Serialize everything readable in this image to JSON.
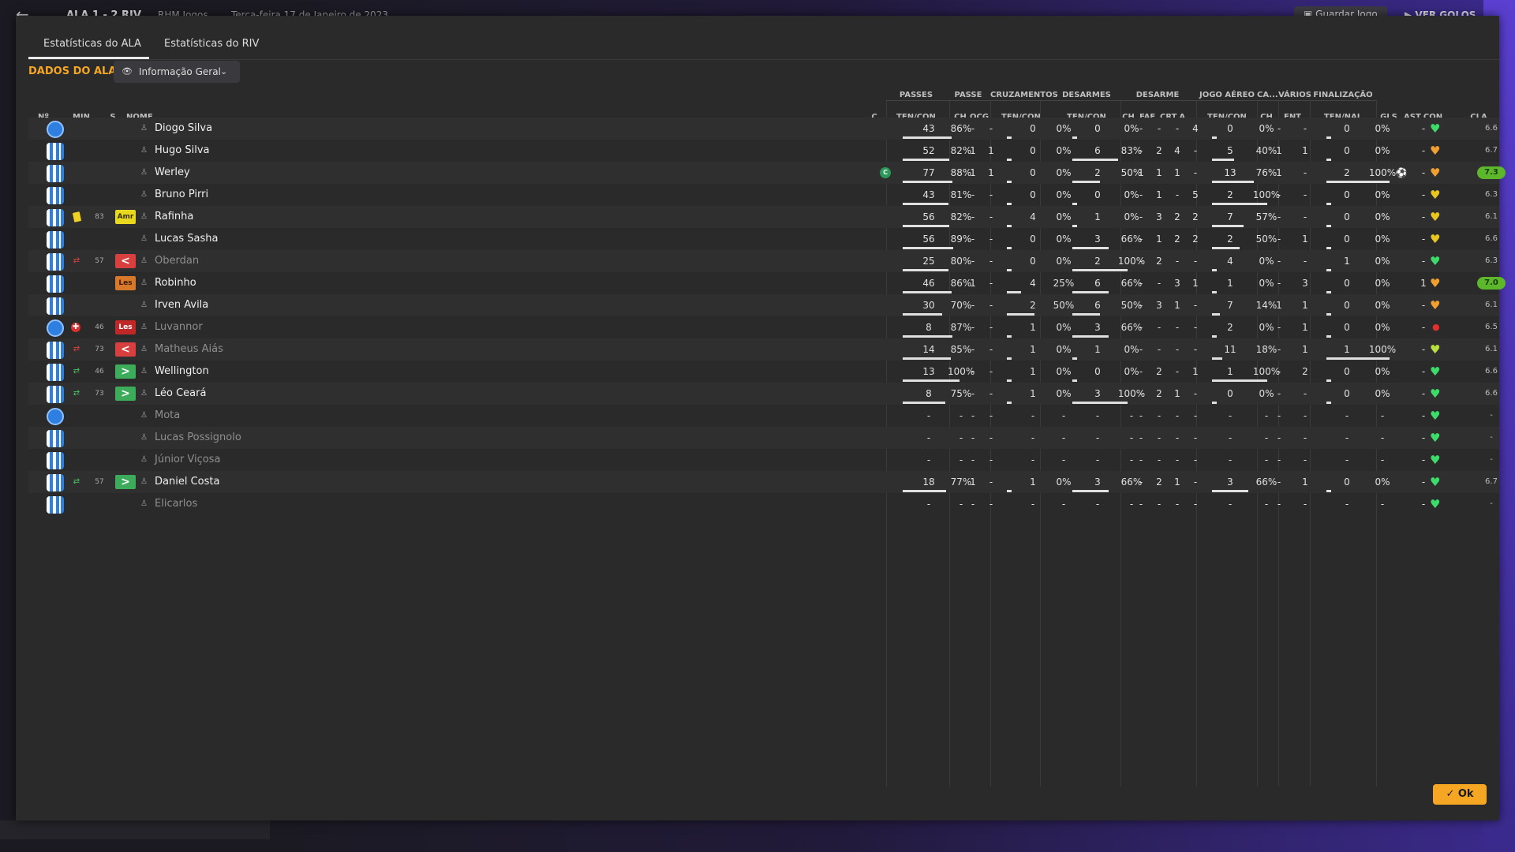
{
  "topbar": {
    "score": "ALA 1 - 2 RIV",
    "opponent": "RHM Jogos",
    "date": "Terça-feira 17 de Janeiro de 2023",
    "save_label": "Guardar Jogo",
    "goals_label": "VER GOLOS"
  },
  "tabs": [
    {
      "label": "Estatísticas do ALA",
      "active": true
    },
    {
      "label": "Estatísticas do RIV",
      "active": false
    }
  ],
  "section_title": "DADOS DO ALA",
  "view_select": {
    "value": "Informação Geral"
  },
  "column_groups": [
    "PASSES",
    "PASSE",
    "CRUZAMENTOS",
    "DESARMES",
    "DESARME",
    "JOGO AÉREO",
    "CA...",
    "VÁRIOS",
    "FINALIZAÇÃO"
  ],
  "column_headers": {
    "num": "Nº",
    "min": "MIN",
    "s": "S",
    "nome": "NOME",
    "c": "C",
    "passes": "TEN/CON",
    "passe_ch": "CH",
    "passe_ocg": "OCG",
    "cruz": "TEN/CON",
    "desarmes": "TEN/CON",
    "des_ch": "CH",
    "des_faf": "FAF",
    "des_crt": "CRT",
    "des_a": "A...",
    "aereo": "TEN/CON",
    "ca_ch": "CH",
    "varios_fnt": "FNT",
    "final": "TEN/NAL",
    "gls": "GLS",
    "ast": "AST",
    "con": "CON",
    "cla": "CLA"
  },
  "colors": {
    "accent": "#f5a623",
    "good_rating": "#5cb82a",
    "kit_blue": "#2e7fe0"
  },
  "players": [
    {
      "name": "Diogo Silva",
      "kit": "gk",
      "evt": "",
      "min": "",
      "sub": "",
      "pass": [
        "43",
        "86%"
      ],
      "pch": "-",
      "pocg": "-",
      "cr": [
        "0",
        "0%"
      ],
      "ds": [
        "0",
        "0%"
      ],
      "dch": "-",
      "faf": "-",
      "crt": "-",
      "da": "4",
      "ae": [
        "0",
        "0%"
      ],
      "cach": "-",
      "fnt": "-",
      "fn": [
        "0",
        "0%"
      ],
      "gls": "",
      "ast": "-",
      "heart": "green",
      "cla": "6.6",
      "claGood": false
    },
    {
      "name": "Hugo Silva",
      "kit": "out",
      "evt": "",
      "min": "",
      "sub": "",
      "pass": [
        "52",
        "82%"
      ],
      "pch": "1",
      "pocg": "1",
      "cr": [
        "0",
        "0%"
      ],
      "ds": [
        "6",
        "83%"
      ],
      "dch": "-",
      "faf": "2",
      "crt": "4",
      "da": "-",
      "ae": [
        "5",
        "40%"
      ],
      "cach": "1",
      "fnt": "1",
      "fn": [
        "0",
        "0%"
      ],
      "gls": "",
      "ast": "-",
      "heart": "orange",
      "cla": "6.7",
      "claGood": false
    },
    {
      "name": "Werley",
      "kit": "out",
      "evt": "",
      "min": "",
      "sub": "",
      "cap": "C",
      "pass": [
        "77",
        "88%"
      ],
      "pch": "1",
      "pocg": "1",
      "cr": [
        "0",
        "0%"
      ],
      "ds": [
        "2",
        "50%"
      ],
      "dch": "1",
      "faf": "1",
      "crt": "1",
      "da": "-",
      "ae": [
        "13",
        "76%"
      ],
      "cach": "1",
      "fnt": "-",
      "fn": [
        "2",
        "100%"
      ],
      "gls": "⚽",
      "ast": "-",
      "heart": "orange",
      "cla": "7.3",
      "claGood": true
    },
    {
      "name": "Bruno Pirri",
      "kit": "out",
      "evt": "",
      "min": "",
      "sub": "",
      "pass": [
        "43",
        "81%"
      ],
      "pch": "-",
      "pocg": "-",
      "cr": [
        "0",
        "0%"
      ],
      "ds": [
        "0",
        "0%"
      ],
      "dch": "-",
      "faf": "1",
      "crt": "-",
      "da": "5",
      "ae": [
        "2",
        "100%"
      ],
      "cach": "-",
      "fnt": "-",
      "fn": [
        "0",
        "0%"
      ],
      "gls": "",
      "ast": "-",
      "heart": "yellow",
      "cla": "6.3",
      "claGood": false
    },
    {
      "name": "Rafinha",
      "kit": "out",
      "evt": "yellow",
      "min": "83",
      "sub": "Amr",
      "subType": "amr",
      "pass": [
        "56",
        "82%"
      ],
      "pch": "-",
      "pocg": "-",
      "cr": [
        "4",
        "0%"
      ],
      "ds": [
        "1",
        "0%"
      ],
      "dch": "-",
      "faf": "3",
      "crt": "2",
      "da": "2",
      "ae": [
        "7",
        "57%"
      ],
      "cach": "-",
      "fnt": "-",
      "fn": [
        "0",
        "0%"
      ],
      "gls": "",
      "ast": "-",
      "heart": "yellow",
      "cla": "6.1",
      "claGood": false
    },
    {
      "name": "Lucas Sasha",
      "kit": "out",
      "evt": "",
      "min": "",
      "sub": "",
      "pass": [
        "56",
        "89%"
      ],
      "pch": "-",
      "pocg": "-",
      "cr": [
        "0",
        "0%"
      ],
      "ds": [
        "3",
        "66%"
      ],
      "dch": "-",
      "faf": "1",
      "crt": "2",
      "da": "2",
      "ae": [
        "2",
        "50%"
      ],
      "cach": "-",
      "fnt": "1",
      "fn": [
        "0",
        "0%"
      ],
      "gls": "",
      "ast": "-",
      "heart": "yellow",
      "cla": "6.6",
      "claGood": false
    },
    {
      "name": "Oberdan",
      "kit": "out",
      "evt": "subout",
      "min": "57",
      "sub": "<",
      "subType": "out",
      "dim": true,
      "pass": [
        "25",
        "80%"
      ],
      "pch": "-",
      "pocg": "-",
      "cr": [
        "0",
        "0%"
      ],
      "ds": [
        "2",
        "100%"
      ],
      "dch": "-",
      "faf": "2",
      "crt": "-",
      "da": "-",
      "ae": [
        "4",
        "0%"
      ],
      "cach": "-",
      "fnt": "-",
      "fn": [
        "1",
        "0%"
      ],
      "gls": "",
      "ast": "-",
      "heart": "green",
      "cla": "6.3",
      "claGood": false
    },
    {
      "name": "Robinho",
      "kit": "out",
      "evt": "",
      "min": "",
      "sub": "Les",
      "subType": "les",
      "pass": [
        "46",
        "86%"
      ],
      "pch": "1",
      "pocg": "-",
      "cr": [
        "4",
        "25%"
      ],
      "ds": [
        "6",
        "66%"
      ],
      "dch": "-",
      "faf": "-",
      "crt": "3",
      "da": "1",
      "ae": [
        "1",
        "0%"
      ],
      "cach": "-",
      "fnt": "3",
      "fn": [
        "0",
        "0%"
      ],
      "gls": "",
      "ast": "1",
      "heart": "orange",
      "cla": "7.0",
      "claGood": true
    },
    {
      "name": "Irven Avila",
      "kit": "out",
      "evt": "",
      "min": "",
      "sub": "",
      "pass": [
        "30",
        "70%"
      ],
      "pch": "-",
      "pocg": "-",
      "cr": [
        "2",
        "50%"
      ],
      "ds": [
        "6",
        "50%"
      ],
      "dch": "-",
      "faf": "3",
      "crt": "1",
      "da": "-",
      "ae": [
        "7",
        "14%"
      ],
      "cach": "1",
      "fnt": "1",
      "fn": [
        "0",
        "0%"
      ],
      "gls": "",
      "ast": "-",
      "heart": "orange",
      "cla": "6.1",
      "claGood": false
    },
    {
      "name": "Luvannor",
      "kit": "gk",
      "evt": "injury",
      "min": "46",
      "sub": "Les",
      "subType": "lesred",
      "dim": true,
      "pass": [
        "8",
        "87%"
      ],
      "pch": "-",
      "pocg": "-",
      "cr": [
        "1",
        "0%"
      ],
      "ds": [
        "3",
        "66%"
      ],
      "dch": "-",
      "faf": "-",
      "crt": "-",
      "da": "-",
      "ae": [
        "2",
        "0%"
      ],
      "cach": "-",
      "fnt": "1",
      "fn": [
        "0",
        "0%"
      ],
      "gls": "",
      "ast": "-",
      "heart": "red",
      "cla": "6.5",
      "claGood": false
    },
    {
      "name": "Matheus Aiás",
      "kit": "out",
      "evt": "subout",
      "min": "73",
      "sub": "<",
      "subType": "out",
      "dim": true,
      "pass": [
        "14",
        "85%"
      ],
      "pch": "-",
      "pocg": "-",
      "cr": [
        "1",
        "0%"
      ],
      "ds": [
        "1",
        "0%"
      ],
      "dch": "-",
      "faf": "-",
      "crt": "-",
      "da": "-",
      "ae": [
        "11",
        "18%"
      ],
      "cach": "-",
      "fnt": "1",
      "fn": [
        "1",
        "100%"
      ],
      "gls": "",
      "ast": "-",
      "heart": "lime",
      "cla": "6.1",
      "claGood": false
    },
    {
      "name": "Wellington",
      "kit": "out",
      "evt": "subin",
      "min": "46",
      "sub": ">",
      "subType": "in",
      "pass": [
        "13",
        "100%"
      ],
      "pch": "-",
      "pocg": "-",
      "cr": [
        "1",
        "0%"
      ],
      "ds": [
        "0",
        "0%"
      ],
      "dch": "-",
      "faf": "2",
      "crt": "-",
      "da": "1",
      "ae": [
        "1",
        "100%"
      ],
      "cach": "-",
      "fnt": "2",
      "fn": [
        "0",
        "0%"
      ],
      "gls": "",
      "ast": "-",
      "heart": "green",
      "cla": "6.6",
      "claGood": false
    },
    {
      "name": "Léo Ceará",
      "kit": "out",
      "evt": "subin",
      "min": "73",
      "sub": ">",
      "subType": "in",
      "pass": [
        "8",
        "75%"
      ],
      "pch": "-",
      "pocg": "-",
      "cr": [
        "1",
        "0%"
      ],
      "ds": [
        "3",
        "100%"
      ],
      "dch": "-",
      "faf": "2",
      "crt": "1",
      "da": "-",
      "ae": [
        "0",
        "0%"
      ],
      "cach": "-",
      "fnt": "-",
      "fn": [
        "0",
        "0%"
      ],
      "gls": "",
      "ast": "-",
      "heart": "green",
      "cla": "6.6",
      "claGood": false
    },
    {
      "name": "Mota",
      "kit": "gk",
      "evt": "",
      "min": "",
      "sub": "",
      "dim": true,
      "pass": [
        "-",
        "-"
      ],
      "pch": "-",
      "pocg": "-",
      "cr": [
        "-",
        "-"
      ],
      "ds": [
        "-",
        "-"
      ],
      "dch": "-",
      "faf": "-",
      "crt": "-",
      "da": "-",
      "ae": [
        "-",
        "-"
      ],
      "cach": "-",
      "fnt": "-",
      "fn": [
        "-",
        "-"
      ],
      "gls": "",
      "ast": "-",
      "heart": "green",
      "cla": "-",
      "claGood": false
    },
    {
      "name": "Lucas Possignolo",
      "kit": "out",
      "evt": "",
      "min": "",
      "sub": "",
      "dim": true,
      "pass": [
        "-",
        "-"
      ],
      "pch": "-",
      "pocg": "-",
      "cr": [
        "-",
        "-"
      ],
      "ds": [
        "-",
        "-"
      ],
      "dch": "-",
      "faf": "-",
      "crt": "-",
      "da": "-",
      "ae": [
        "-",
        "-"
      ],
      "cach": "-",
      "fnt": "-",
      "fn": [
        "-",
        "-"
      ],
      "gls": "",
      "ast": "-",
      "heart": "green",
      "cla": "-",
      "claGood": false
    },
    {
      "name": "Júnior Viçosa",
      "kit": "out",
      "evt": "",
      "min": "",
      "sub": "",
      "dim": true,
      "pass": [
        "-",
        "-"
      ],
      "pch": "-",
      "pocg": "-",
      "cr": [
        "-",
        "-"
      ],
      "ds": [
        "-",
        "-"
      ],
      "dch": "-",
      "faf": "-",
      "crt": "-",
      "da": "-",
      "ae": [
        "-",
        "-"
      ],
      "cach": "-",
      "fnt": "-",
      "fn": [
        "-",
        "-"
      ],
      "gls": "",
      "ast": "-",
      "heart": "green",
      "cla": "-",
      "claGood": false
    },
    {
      "name": "Daniel Costa",
      "kit": "out",
      "evt": "subin",
      "min": "57",
      "sub": ">",
      "subType": "in",
      "pass": [
        "18",
        "77%"
      ],
      "pch": "1",
      "pocg": "-",
      "cr": [
        "1",
        "0%"
      ],
      "ds": [
        "3",
        "66%"
      ],
      "dch": "-",
      "faf": "2",
      "crt": "1",
      "da": "-",
      "ae": [
        "3",
        "66%"
      ],
      "cach": "-",
      "fnt": "1",
      "fn": [
        "0",
        "0%"
      ],
      "gls": "",
      "ast": "-",
      "heart": "green",
      "cla": "6.7",
      "claGood": false
    },
    {
      "name": "Elicarlos",
      "kit": "out",
      "evt": "",
      "min": "",
      "sub": "",
      "dim": true,
      "pass": [
        "-",
        "-"
      ],
      "pch": "-",
      "pocg": "-",
      "cr": [
        "-",
        "-"
      ],
      "ds": [
        "-",
        "-"
      ],
      "dch": "-",
      "faf": "-",
      "crt": "-",
      "da": "-",
      "ae": [
        "-",
        "-"
      ],
      "cach": "-",
      "fnt": "-",
      "fn": [
        "-",
        "-"
      ],
      "gls": "",
      "ast": "-",
      "heart": "green",
      "cla": "-",
      "claGood": false
    }
  ],
  "ok_label": "Ok"
}
